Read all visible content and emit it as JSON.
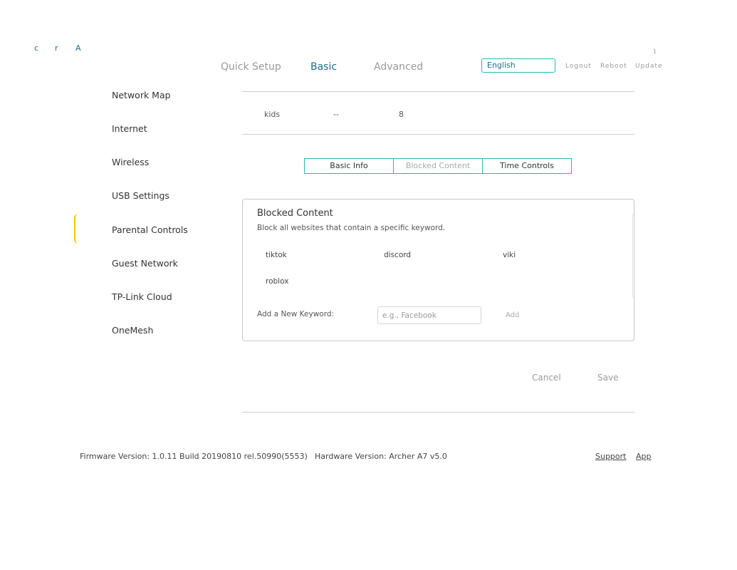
{
  "logo": {
    "letters": [
      "c",
      "r",
      "A"
    ]
  },
  "topnav": {
    "quick_setup": "Quick Setup",
    "basic": "Basic",
    "advanced": "Advanced",
    "language": "English",
    "logout": "Logout",
    "reboot": "Reboot",
    "update": "Update",
    "notification_count": "1"
  },
  "sidebar": {
    "items": [
      {
        "label": "Network Map"
      },
      {
        "label": "Internet"
      },
      {
        "label": "Wireless"
      },
      {
        "label": "USB Settings"
      },
      {
        "label": "Parental Controls",
        "active": true
      },
      {
        "label": "Guest Network"
      },
      {
        "label": "TP-Link Cloud"
      },
      {
        "label": "OneMesh"
      }
    ]
  },
  "profile": {
    "name": "kids",
    "devices": "--",
    "value": "8"
  },
  "tabs": {
    "basic_info": "Basic Info",
    "blocked_content": "Blocked Content",
    "time_controls": "Time Controls"
  },
  "blocked": {
    "title": "Blocked Content",
    "description": "Block all websites that contain a specific keyword.",
    "keywords": [
      "tiktok",
      "discord",
      "viki",
      "roblox"
    ],
    "add_label": "Add a New Keyword:",
    "input_value": "",
    "input_placeholder": "e.g., Facebook",
    "add_button": "Add"
  },
  "actions": {
    "cancel": "Cancel",
    "save": "Save"
  },
  "footer": {
    "firmware": "Firmware Version: 1.0.11 Build 20190810 rel.50990(5553)",
    "hardware": "Hardware Version: Archer A7 v5.0",
    "support": "Support",
    "app": "App"
  },
  "colors": {
    "accent": "#1a6e8c",
    "border_accent": "#2bb5b8",
    "active_indicator": "#f3c700"
  }
}
